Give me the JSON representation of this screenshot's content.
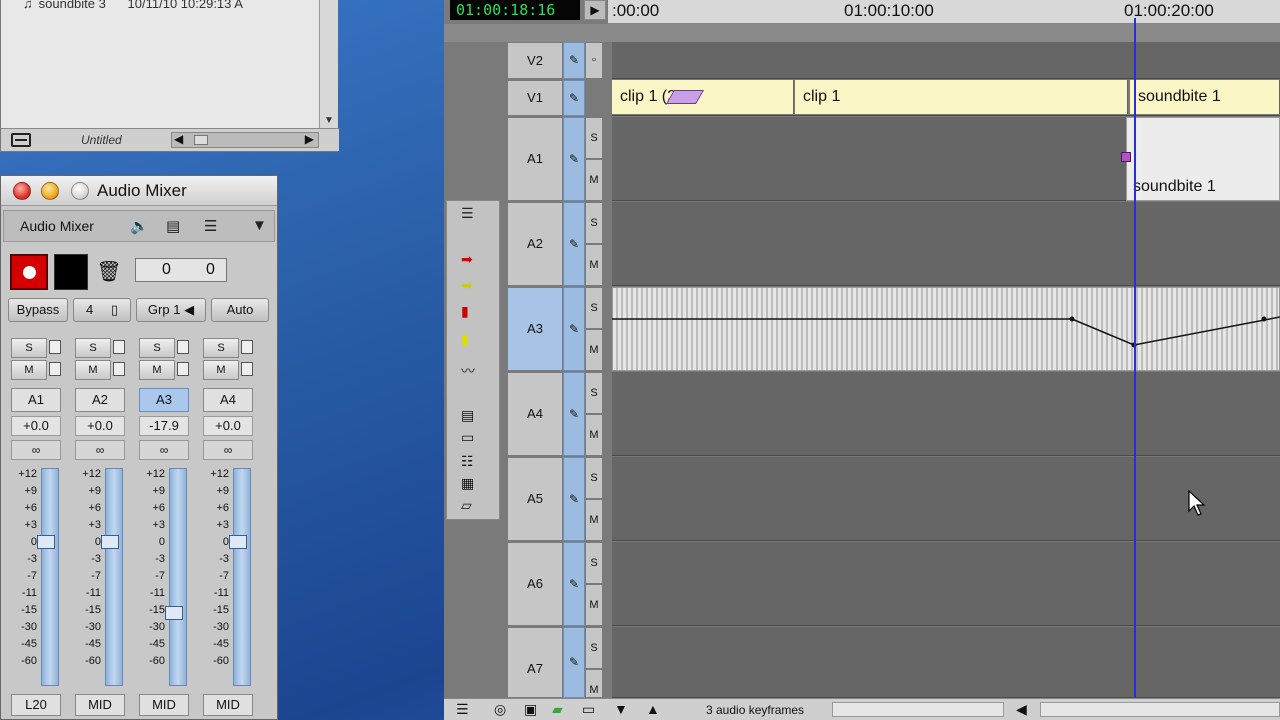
{
  "bin": {
    "row_name": "soundbite 3",
    "row_date": "10/11/10 10:29:13 A",
    "status_title": "Untitled"
  },
  "mixer": {
    "window_title": "Audio Mixer",
    "menu_label": "Audio Mixer",
    "counter_left": "0",
    "counter_right": "0",
    "bypass_label": "Bypass",
    "bank_label": "4",
    "group_label": "Grp 1",
    "auto_label": "Auto",
    "solo_label": "S",
    "mute_label": "M",
    "scale": [
      "+12",
      "+9",
      "+6",
      "+3",
      "0",
      "-3",
      "-7",
      "-11",
      "-15",
      "-30",
      "-45",
      "-60"
    ],
    "channels": [
      {
        "name": "A1",
        "gain": "+0.0",
        "pan": "L20",
        "level": 0
      },
      {
        "name": "A2",
        "gain": "+0.0",
        "pan": "MID",
        "level": 0
      },
      {
        "name": "A3",
        "gain": "-17.9",
        "pan": "MID",
        "level": -17.9
      },
      {
        "name": "A4",
        "gain": "+0.0",
        "pan": "MID",
        "level": 0
      }
    ]
  },
  "timeline": {
    "timecode": "01:00:18:16",
    "ruler": [
      ":00:00",
      "01:00:10:00",
      "01:00:20:00"
    ],
    "tracks": {
      "v2": "V2",
      "v1": "V1",
      "a1": "A1",
      "a2": "A2",
      "a3": "A3",
      "a4": "A4",
      "a5": "A5",
      "a6": "A6",
      "a7": "A7"
    },
    "solo_label": "S",
    "mute_label": "M",
    "clips": {
      "v1_clip_a": "clip 1 (2",
      "v1_clip_b": "clip 1",
      "v1_clip_c": "soundbite 1",
      "a1_clip": "soundbite 1"
    },
    "status_message": "3 audio keyframes"
  },
  "colors": {
    "timecode_text": "#28e15a",
    "playhead": "#2033d8",
    "selected_track": "#a7c3e6",
    "video_clip": "#fbf6c6",
    "record": "#d40000"
  }
}
